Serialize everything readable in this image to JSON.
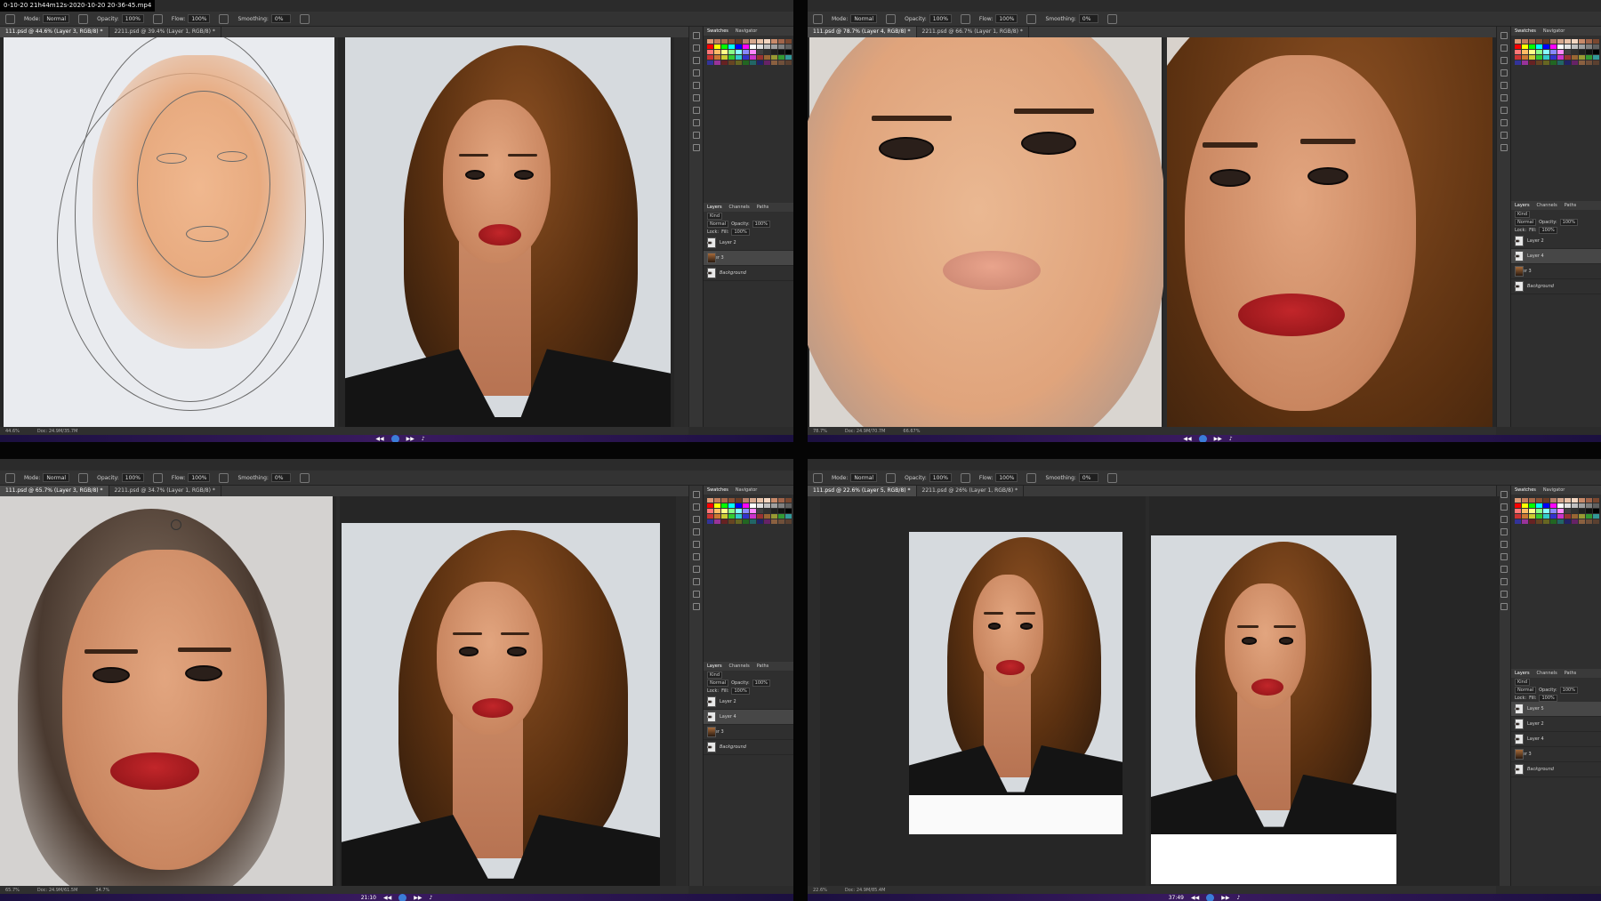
{
  "recording": {
    "filename": "0-10-20 21h44m12s-2020-10-20 20-36-45.mp4"
  },
  "options": {
    "mode_label": "Mode:",
    "mode_value": "Normal",
    "opacity_label": "Opacity:",
    "opacity_value": "100%",
    "flow_label": "Flow:",
    "flow_value": "100%",
    "smoothing_label": "Smoothing:",
    "smoothing_value": "0%"
  },
  "quadrants": [
    {
      "tabs": [
        "111.psd @ 44.6% (Layer 3, RGB/8) *",
        "2211.psd @ 39.4% (Layer 1, RGB/8) *"
      ],
      "status": [
        "44.6%",
        "Doc: 24.9M/35.7M"
      ],
      "time": "",
      "layers": [
        {
          "name": "Layer 2",
          "selected": false,
          "bg": false,
          "photo": false
        },
        {
          "name": "Layer 3",
          "selected": true,
          "bg": false,
          "photo": true
        },
        {
          "name": "Background",
          "selected": false,
          "bg": true,
          "photo": false
        }
      ]
    },
    {
      "tabs": [
        "111.psd @ 78.7% (Layer 4, RGB/8) *",
        "2211.psd @ 66.7% (Layer 1, RGB/8) *"
      ],
      "status": [
        "78.7%",
        "Doc: 24.9M/70.7M",
        "66.67%"
      ],
      "time": "",
      "layers": [
        {
          "name": "Layer 2",
          "selected": false,
          "bg": false,
          "photo": false
        },
        {
          "name": "Layer 4",
          "selected": true,
          "bg": false,
          "photo": false
        },
        {
          "name": "Layer 3",
          "selected": false,
          "bg": false,
          "photo": true
        },
        {
          "name": "Background",
          "selected": false,
          "bg": true,
          "photo": false
        }
      ]
    },
    {
      "tabs": [
        "111.psd @ 65.7% (Layer 3, RGB/8) *",
        "2211.psd @ 34.7% (Layer 1, RGB/8) *"
      ],
      "status": [
        "65.7%",
        "Doc: 24.9M/61.5M",
        "34.7%"
      ],
      "time": "21:10",
      "layers": [
        {
          "name": "Layer 2",
          "selected": false,
          "bg": false,
          "photo": false
        },
        {
          "name": "Layer 4",
          "selected": true,
          "bg": false,
          "photo": false
        },
        {
          "name": "Layer 3",
          "selected": false,
          "bg": false,
          "photo": true
        },
        {
          "name": "Background",
          "selected": false,
          "bg": true,
          "photo": false
        }
      ]
    },
    {
      "tabs": [
        "111.psd @ 22.6% (Layer 5, RGB/8) *",
        "2211.psd @ 26% (Layer 1, RGB/8) *"
      ],
      "status": [
        "22.6%",
        "Doc: 24.9M/85.4M"
      ],
      "time": "37:49",
      "layers": [
        {
          "name": "Layer 5",
          "selected": true,
          "bg": false,
          "photo": false
        },
        {
          "name": "Layer 2",
          "selected": false,
          "bg": false,
          "photo": false
        },
        {
          "name": "Layer 4",
          "selected": false,
          "bg": false,
          "photo": false
        },
        {
          "name": "Layer 3",
          "selected": false,
          "bg": false,
          "photo": true
        },
        {
          "name": "Background",
          "selected": false,
          "bg": true,
          "photo": false
        }
      ]
    }
  ],
  "panel": {
    "swatches_tab": "Swatches",
    "navigator_tab": "Navigator",
    "layers_tab": "Layers",
    "channels_tab": "Channels",
    "paths_tab": "Paths",
    "kind_label": "Kind",
    "blend_value": "Normal",
    "opacity_label": "Opacity:",
    "opacity_value": "100%",
    "lock_label": "Lock:",
    "fill_label": "Fill:",
    "fill_value": "100%"
  },
  "colors": {
    "ui_dark": "#2b2b2b",
    "panel": "#2f2f2f",
    "lip_red": "#b01d22",
    "hair_brown": "#7a4520",
    "skin": "#d89a72"
  }
}
